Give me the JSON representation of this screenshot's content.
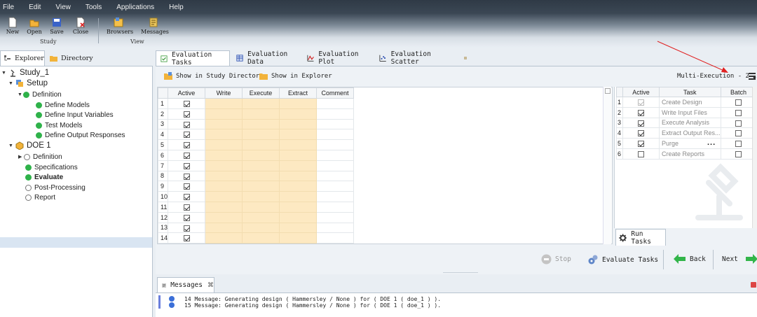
{
  "menu": [
    "File",
    "Edit",
    "View",
    "Tools",
    "Applications",
    "Help"
  ],
  "toolbar": {
    "study_buttons": [
      "New",
      "Open",
      "Save",
      "Close"
    ],
    "study_group": "Study",
    "view_buttons": [
      "Browsers",
      "Messages"
    ],
    "view_group": "View"
  },
  "left_tabs": [
    "Explorer",
    "Directory"
  ],
  "tree": {
    "study": "Study_1",
    "setup": "Setup",
    "setup_definition": "Definition",
    "define_models": "Define Models",
    "define_input_variables": "Define Input Variables",
    "test_models": "Test Models",
    "define_output_responses": "Define Output Responses",
    "doe": "DOE 1",
    "doe_definition": "Definition",
    "specifications": "Specifications",
    "evaluate": "Evaluate",
    "post_processing": "Post-Processing",
    "report": "Report"
  },
  "main_tabs": [
    "Evaluation Tasks",
    "Evaluation Data",
    "Evaluation Plot",
    "Evaluation Scatter"
  ],
  "sub_toolbar": {
    "show_in_study_directory": "Show in Study Directory",
    "show_in_explorer": "Show in Explorer",
    "multi_execution": "Multi-Execution - 2"
  },
  "eval_grid": {
    "columns": [
      "Active",
      "Write",
      "Execute",
      "Extract",
      "Comment"
    ],
    "row_numbers": [
      "1",
      "2",
      "3",
      "4",
      "5",
      "6",
      "7",
      "8",
      "9",
      "10",
      "11",
      "12",
      "13",
      "14"
    ],
    "active": [
      true,
      true,
      true,
      true,
      true,
      true,
      true,
      true,
      true,
      true,
      true,
      true,
      true,
      true
    ]
  },
  "task_table": {
    "columns": [
      "Active",
      "Task",
      "Batch"
    ],
    "rows": [
      {
        "n": "1",
        "task": "Create Design",
        "active": true,
        "disabled": true,
        "batch": false
      },
      {
        "n": "2",
        "task": "Write Input Files",
        "active": true,
        "disabled": false,
        "batch": false
      },
      {
        "n": "3",
        "task": "Execute Analysis",
        "active": true,
        "disabled": false,
        "batch": false
      },
      {
        "n": "4",
        "task": "Extract Output Res...",
        "active": true,
        "disabled": false,
        "batch": false
      },
      {
        "n": "5",
        "task": "Purge",
        "active": true,
        "disabled": false,
        "batch": false
      },
      {
        "n": "6",
        "task": "Create Reports",
        "active": false,
        "disabled": false,
        "batch": false
      }
    ],
    "ellipsis": "..."
  },
  "run_tasks_tab": "Run Tasks",
  "actions": {
    "stop": "Stop",
    "evaluate_tasks": "Evaluate Tasks",
    "back": "Back",
    "next": "Next"
  },
  "messages": {
    "tab_label": "Messages",
    "lines": [
      "14 Message: Generating design ( Hammersley / None ) for ( DOE 1 ( doe_1 ) ).",
      "15 Message: Generating design ( Hammersley / None ) for ( DOE 1 ( doe_1 ) )."
    ]
  },
  "colors": {
    "accent_green": "#2fb24a",
    "yellow_cell": "#fde9c2",
    "arrow_red": "#e02020"
  }
}
